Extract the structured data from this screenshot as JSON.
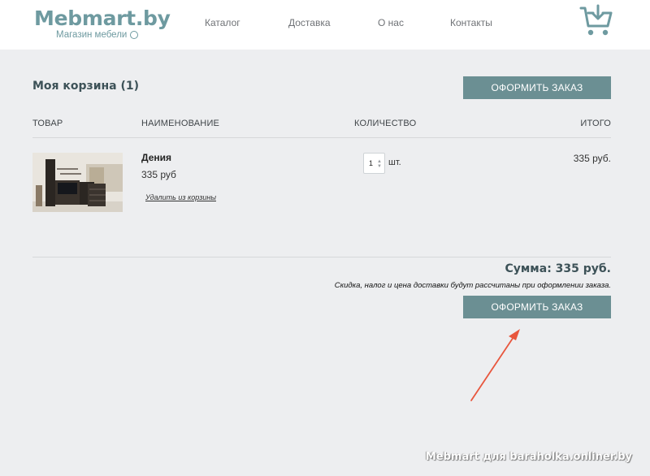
{
  "header": {
    "logo_title": "Mebmart.by",
    "logo_subtitle": "Магазин мебели",
    "nav": {
      "catalog": "Каталог",
      "delivery": "Доставка",
      "about": "О нас",
      "contacts": "Контакты"
    },
    "cart_icon": "cart-download-icon"
  },
  "cart": {
    "title": "Моя корзина (1)",
    "checkout_label": "ОФОРМИТЬ ЗАКАЗ",
    "columns": {
      "product": "ТОВАР",
      "name": "НАИМЕНОВАНИЕ",
      "quantity": "КОЛИЧЕСТВО",
      "total": "ИТОГО"
    },
    "items": [
      {
        "name": "Дения",
        "price": "335 руб",
        "remove_label": "Удалить из корзины",
        "quantity": "1",
        "unit": "шт.",
        "total": "335 руб."
      }
    ],
    "sum": "Сумма: 335 руб.",
    "note": "Скидка, налог и цена доставки будут рассчитаны при оформлении заказа."
  },
  "annotation": {
    "color": "#e8563d"
  },
  "watermark": "Mebmart для baraholka.onliner.by",
  "colors": {
    "brand": "#6e9aa0",
    "button": "#6b8f93",
    "background": "#edeef0"
  }
}
